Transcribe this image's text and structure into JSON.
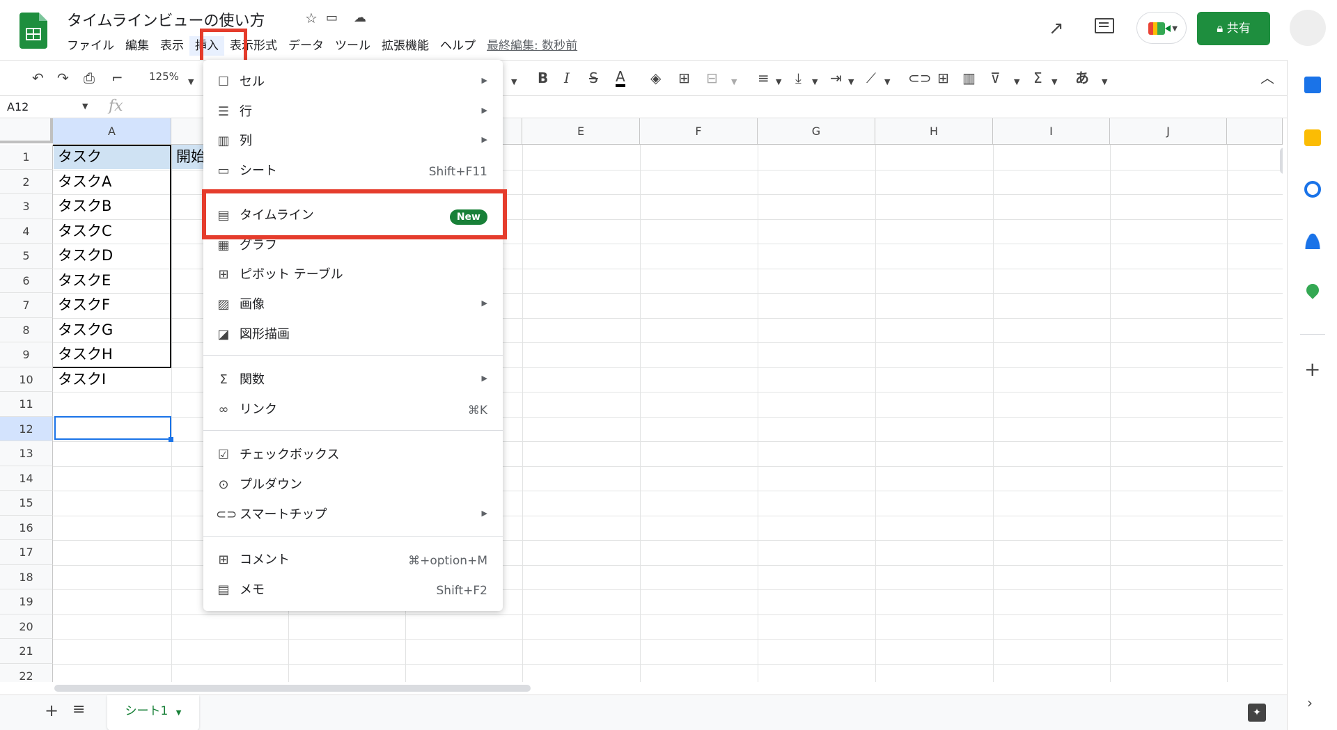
{
  "app": {
    "title": "タイムラインビューの使い方",
    "last_edit": "最終編集: 数秒前",
    "share_label": "共有",
    "menus": [
      "ファイル",
      "編集",
      "表示",
      "挿入",
      "表示形式",
      "データ",
      "ツール",
      "拡張機能",
      "ヘルプ"
    ],
    "active_menu": "挿入"
  },
  "toolbar": {
    "zoom": "125%",
    "input_mode": "あ"
  },
  "formula_bar": {
    "name_box": "A12",
    "fx": "fx"
  },
  "grid": {
    "column_headers": [
      "A",
      "",
      "",
      "",
      "E",
      "F",
      "G",
      "H",
      "I",
      "J"
    ],
    "row_headers": [
      "1",
      "2",
      "3",
      "4",
      "5",
      "6",
      "7",
      "8",
      "9",
      "10",
      "11",
      "12",
      "13",
      "14",
      "15",
      "16",
      "17",
      "18",
      "19",
      "20",
      "21",
      "22"
    ],
    "selected_cell": "A12",
    "header_cells": [
      "タスク",
      "開始"
    ],
    "tasks": [
      "タスクA",
      "タスクB",
      "タスクC",
      "タスクD",
      "タスクE",
      "タスクF",
      "タスクG",
      "タスクH",
      "タスクI"
    ]
  },
  "insert_menu": {
    "items": [
      {
        "label": "セル",
        "icon": "cell-icon",
        "submenu": true
      },
      {
        "label": "行",
        "icon": "row-icon",
        "submenu": true
      },
      {
        "label": "列",
        "icon": "column-icon",
        "submenu": true
      },
      {
        "label": "シート",
        "icon": "sheet-icon",
        "shortcut": "Shift+F11"
      },
      {
        "label": "タイムライン",
        "icon": "timeline-icon",
        "badge": "New"
      },
      {
        "label": "グラフ",
        "icon": "chart-icon"
      },
      {
        "label": "ピボット テーブル",
        "icon": "pivot-table-icon"
      },
      {
        "label": "画像",
        "icon": "image-icon",
        "submenu": true
      },
      {
        "label": "図形描画",
        "icon": "drawing-icon"
      },
      {
        "label": "関数",
        "icon": "sigma-icon",
        "submenu": true
      },
      {
        "label": "リンク",
        "icon": "link-icon",
        "shortcut": "⌘K"
      },
      {
        "label": "チェックボックス",
        "icon": "checkbox-icon"
      },
      {
        "label": "プルダウン",
        "icon": "dropdown-icon"
      },
      {
        "label": "スマートチップ",
        "icon": "smart-chip-icon",
        "submenu": true
      },
      {
        "label": "コメント",
        "icon": "comment-add-icon",
        "shortcut": "⌘+option+M"
      },
      {
        "label": "メモ",
        "icon": "note-icon",
        "shortcut": "Shift+F2"
      }
    ]
  },
  "sheets": {
    "active": "シート1"
  },
  "colors": {
    "brand_green": "#1e8e3e",
    "highlight_red": "#e53c2c",
    "selection_blue": "#1a73e8",
    "header_cell_fill": "#cfe2f3"
  }
}
